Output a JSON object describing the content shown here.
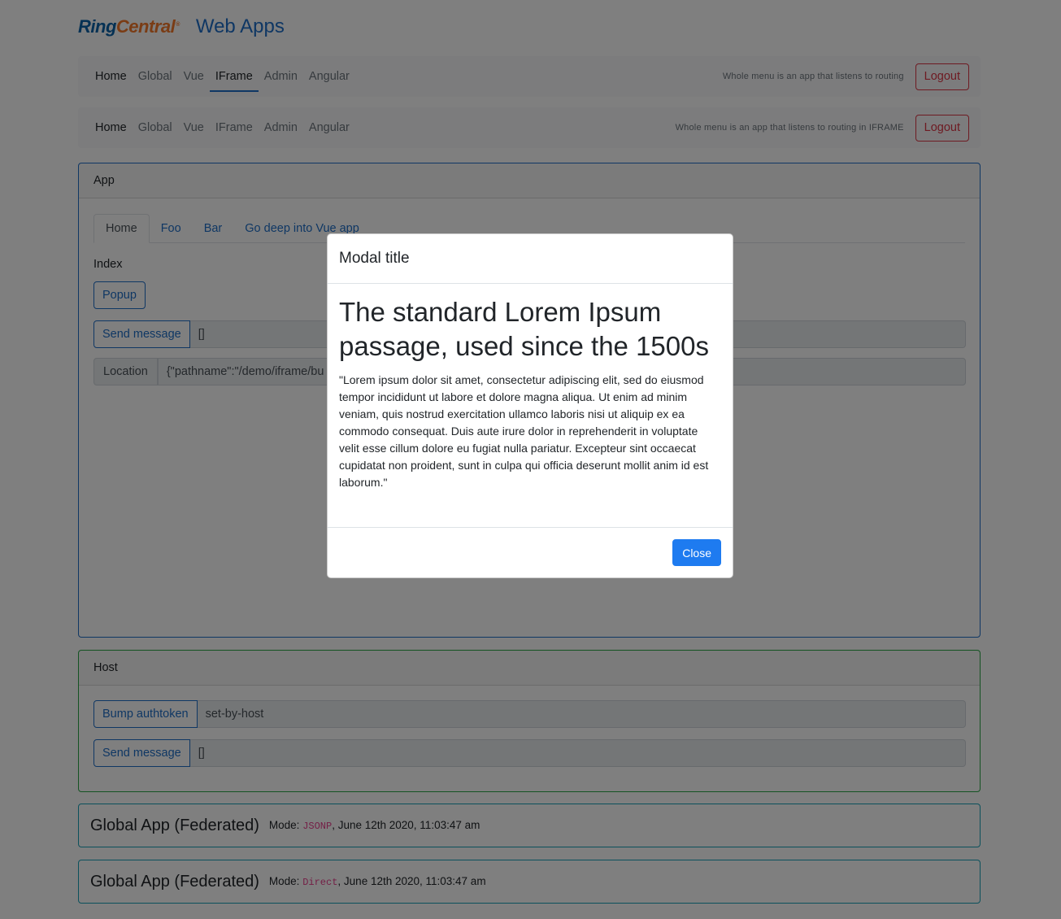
{
  "header": {
    "logo_ring": "Ring",
    "logo_central": "Central",
    "logo_mark": "®",
    "title": "Web Apps"
  },
  "nav_top": {
    "items": [
      "Home",
      "Global",
      "Vue",
      "IFrame",
      "Admin",
      "Angular"
    ],
    "note": "Whole menu is an app that listens to routing",
    "logout": "Logout"
  },
  "nav_iframe": {
    "items": [
      "Home",
      "Global",
      "Vue",
      "IFrame",
      "Admin",
      "Angular"
    ],
    "note": "Whole menu is an app that listens to routing in IFRAME",
    "logout": "Logout"
  },
  "app_card": {
    "header": "App",
    "tabs": [
      "Home",
      "Foo",
      "Bar",
      "Go deep into Vue app"
    ],
    "index_label": "Index",
    "popup_button": "Popup",
    "send_message_button": "Send message",
    "send_message_value": "[]",
    "location_label": "Location",
    "location_value": "{\"pathname\":\"/demo/iframe/bu"
  },
  "host_card": {
    "header": "Host",
    "bump_button": "Bump authtoken",
    "bump_value": "set-by-host",
    "send_message_button": "Send message",
    "send_message_value": "[]"
  },
  "global_apps": [
    {
      "title": "Global App (Federated)",
      "mode_label": "Mode:",
      "mode": "JSONP",
      "date": ", June 12th 2020, 11:03:47 am"
    },
    {
      "title": "Global App (Federated)",
      "mode_label": "Mode:",
      "mode": "Direct",
      "date": ", June 12th 2020, 11:03:47 am"
    }
  ],
  "modal": {
    "title": "Modal title",
    "heading": "The standard Lorem Ipsum passage, used since the 1500s",
    "body": "\"Lorem ipsum dolor sit amet, consectetur adipiscing elit, sed do eiusmod tempor incididunt ut labore et dolore magna aliqua. Ut enim ad minim veniam, quis nostrud exercitation ullamco laboris nisi ut aliquip ex ea commodo consequat. Duis aute irure dolor in reprehenderit in voluptate velit esse cillum dolore eu fugiat nulla pariatur. Excepteur sint occaecat cupidatat non proident, sunt in culpa qui officia deserunt mollit anim id est laborum.\"",
    "close_button": "Close"
  },
  "colors": {
    "primary": "#1e6ec8",
    "danger": "#dc3545",
    "success": "#28a745",
    "info": "#17a2b8"
  }
}
